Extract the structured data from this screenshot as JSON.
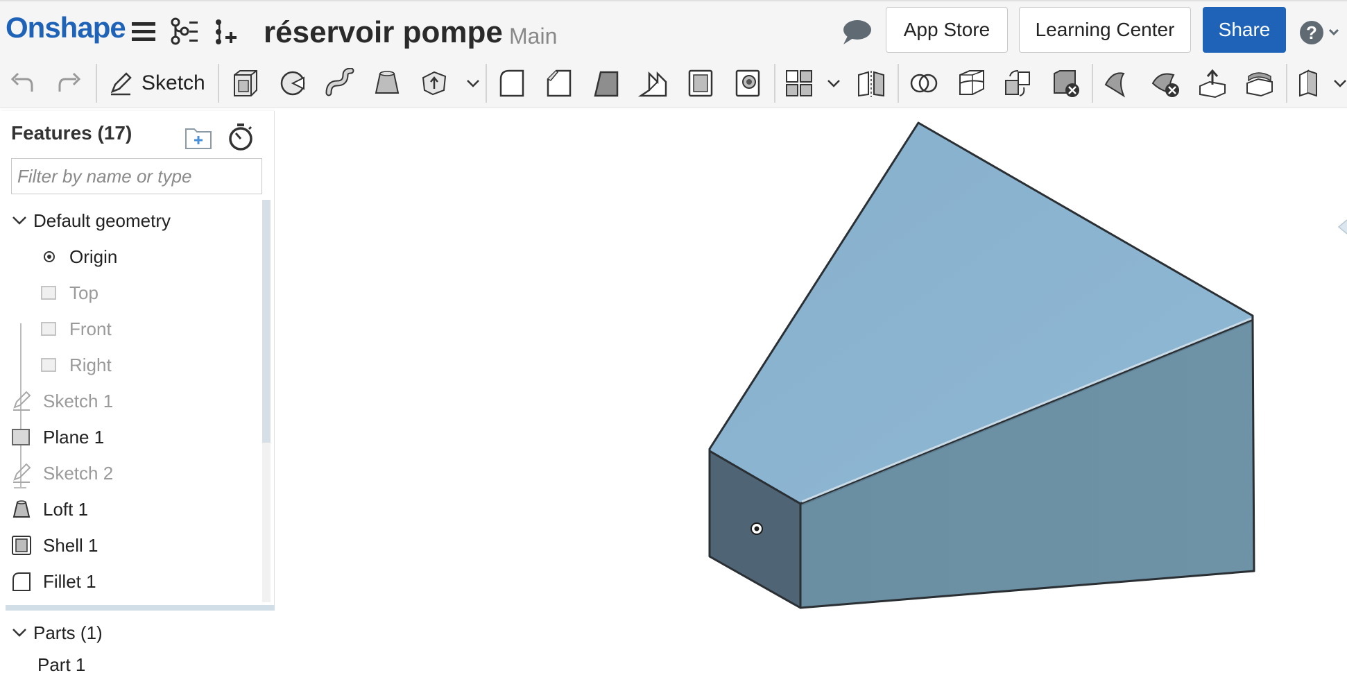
{
  "app": {
    "logo": "Onshape"
  },
  "document": {
    "title": "réservoir pompe",
    "branch": "Main"
  },
  "header": {
    "app_store_label": "App Store",
    "learning_center_label": "Learning Center",
    "share_label": "Share"
  },
  "toolbar": {
    "sketch_label": "Sketch"
  },
  "feature_panel": {
    "title": "Features (17)",
    "filter_placeholder": "Filter by name or type",
    "default_geometry_label": "Default geometry",
    "default_geometry_items": [
      {
        "label": "Origin",
        "icon": "origin-icon"
      },
      {
        "label": "Top",
        "icon": "plane-icon"
      },
      {
        "label": "Front",
        "icon": "plane-icon"
      },
      {
        "label": "Right",
        "icon": "plane-icon"
      }
    ],
    "features": [
      {
        "label": "Sketch 1",
        "icon": "sketch-icon"
      },
      {
        "label": "Plane 1",
        "icon": "plane-icon"
      },
      {
        "label": "Sketch 2",
        "icon": "sketch-icon"
      },
      {
        "label": "Loft 1",
        "icon": "loft-icon"
      },
      {
        "label": "Shell 1",
        "icon": "shell-icon"
      },
      {
        "label": "Fillet 1",
        "icon": "fillet-icon"
      }
    ],
    "parts_label": "Parts (1)",
    "parts": [
      {
        "label": "Part 1"
      }
    ]
  },
  "colors": {
    "brand": "#1f63b8",
    "model_top": "#8ab3cf",
    "model_right": "#6b8fa3",
    "model_front": "#4e6373"
  }
}
